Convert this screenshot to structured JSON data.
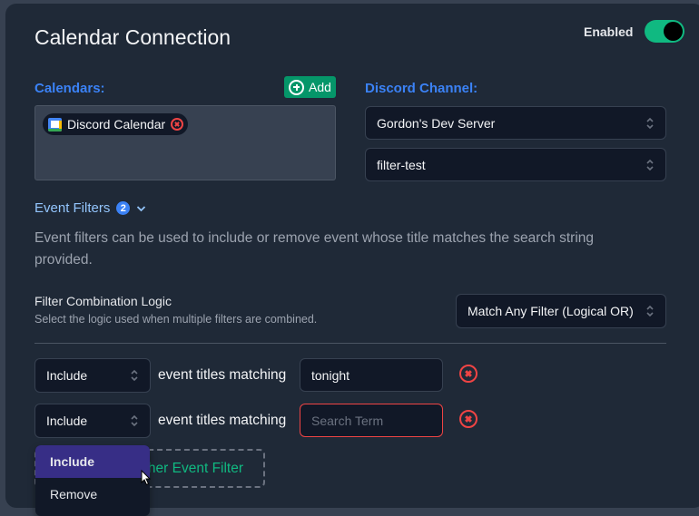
{
  "header": {
    "title": "Calendar Connection",
    "enabled_label": "Enabled",
    "enabled": true
  },
  "calendars": {
    "label": "Calendars:",
    "add_label": "Add",
    "items": [
      {
        "name": "Discord Calendar",
        "icon": "google-calendar-icon"
      }
    ]
  },
  "discord": {
    "label": "Discord Channel:",
    "server": "Gordon's Dev Server",
    "channel": "filter-test"
  },
  "event_filters": {
    "heading": "Event Filters",
    "count": "2",
    "description": "Event filters can be used to include or remove event whose title matches the search string provided.",
    "logic_title": "Filter Combination Logic",
    "logic_subtitle": "Select the logic used when multiple filters are combined.",
    "logic_value": "Match Any Filter (Logical OR)",
    "match_text": "event titles matching",
    "filters": [
      {
        "mode": "Include",
        "term": "tonight",
        "placeholder": "Search Term"
      },
      {
        "mode": "Include",
        "term": "",
        "placeholder": "Search Term"
      }
    ],
    "add_filter_label": "Add Another Event Filter",
    "dropdown_options": [
      "Include",
      "Remove"
    ],
    "dropdown_highlighted": "Include"
  },
  "colors": {
    "accent_blue": "#3b82f6",
    "accent_green": "#10b981",
    "danger": "#ef4444",
    "highlight": "#372e86"
  }
}
